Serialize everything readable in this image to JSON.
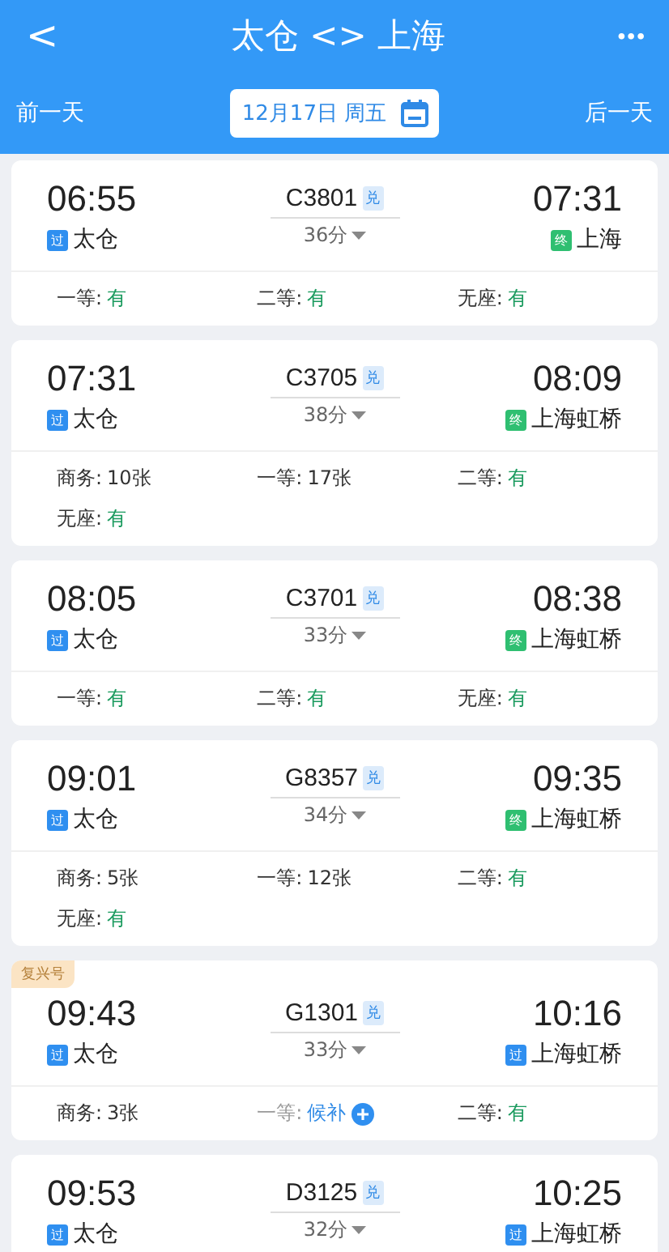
{
  "header": {
    "back": "<",
    "title": "太仓 <> 上海",
    "more": "•••",
    "prev_day": "前一天",
    "date": "12月17日 周五",
    "next_day": "后一天"
  },
  "trains": [
    {
      "depart": "06:55",
      "from": {
        "badge": "过",
        "kind": "pass",
        "name": "太仓"
      },
      "train": "C3801",
      "exchange": "兑",
      "duration": "36分",
      "arrive": "07:31",
      "to": {
        "badge": "终",
        "kind": "terminal",
        "name": "上海"
      },
      "seats": [
        {
          "label": "一等:",
          "value": "有",
          "kind": "available"
        },
        {
          "label": "二等:",
          "value": "有",
          "kind": "available"
        },
        {
          "label": "无座:",
          "value": "有",
          "kind": "available"
        }
      ]
    },
    {
      "depart": "07:31",
      "from": {
        "badge": "过",
        "kind": "pass",
        "name": "太仓"
      },
      "train": "C3705",
      "exchange": "兑",
      "duration": "38分",
      "arrive": "08:09",
      "to": {
        "badge": "终",
        "kind": "terminal",
        "name": "上海虹桥"
      },
      "seats": [
        {
          "label": "商务:",
          "value": "10张",
          "kind": "count"
        },
        {
          "label": "一等:",
          "value": "17张",
          "kind": "count"
        },
        {
          "label": "二等:",
          "value": "有",
          "kind": "available"
        },
        {
          "label": "无座:",
          "value": "有",
          "kind": "available"
        }
      ]
    },
    {
      "depart": "08:05",
      "from": {
        "badge": "过",
        "kind": "pass",
        "name": "太仓"
      },
      "train": "C3701",
      "exchange": "兑",
      "duration": "33分",
      "arrive": "08:38",
      "to": {
        "badge": "终",
        "kind": "terminal",
        "name": "上海虹桥"
      },
      "seats": [
        {
          "label": "一等:",
          "value": "有",
          "kind": "available"
        },
        {
          "label": "二等:",
          "value": "有",
          "kind": "available"
        },
        {
          "label": "无座:",
          "value": "有",
          "kind": "available"
        }
      ]
    },
    {
      "depart": "09:01",
      "from": {
        "badge": "过",
        "kind": "pass",
        "name": "太仓"
      },
      "train": "G8357",
      "exchange": "兑",
      "duration": "34分",
      "arrive": "09:35",
      "to": {
        "badge": "终",
        "kind": "terminal",
        "name": "上海虹桥"
      },
      "seats": [
        {
          "label": "商务:",
          "value": "5张",
          "kind": "count"
        },
        {
          "label": "一等:",
          "value": "12张",
          "kind": "count"
        },
        {
          "label": "二等:",
          "value": "有",
          "kind": "available"
        },
        {
          "label": "无座:",
          "value": "有",
          "kind": "available"
        }
      ]
    },
    {
      "tag": "复兴号",
      "depart": "09:43",
      "from": {
        "badge": "过",
        "kind": "pass",
        "name": "太仓"
      },
      "train": "G1301",
      "exchange": "兑",
      "duration": "33分",
      "arrive": "10:16",
      "to": {
        "badge": "过",
        "kind": "pass",
        "name": "上海虹桥"
      },
      "seats": [
        {
          "label": "商务:",
          "value": "3张",
          "kind": "count"
        },
        {
          "label": "一等:",
          "value": "候补",
          "kind": "waitlist"
        },
        {
          "label": "二等:",
          "value": "有",
          "kind": "available"
        }
      ]
    },
    {
      "depart": "09:53",
      "from": {
        "badge": "过",
        "kind": "pass",
        "name": "太仓"
      },
      "train": "D3125",
      "exchange": "兑",
      "duration": "32分",
      "arrive": "10:25",
      "to": {
        "badge": "过",
        "kind": "pass",
        "name": "上海虹桥"
      }
    }
  ]
}
